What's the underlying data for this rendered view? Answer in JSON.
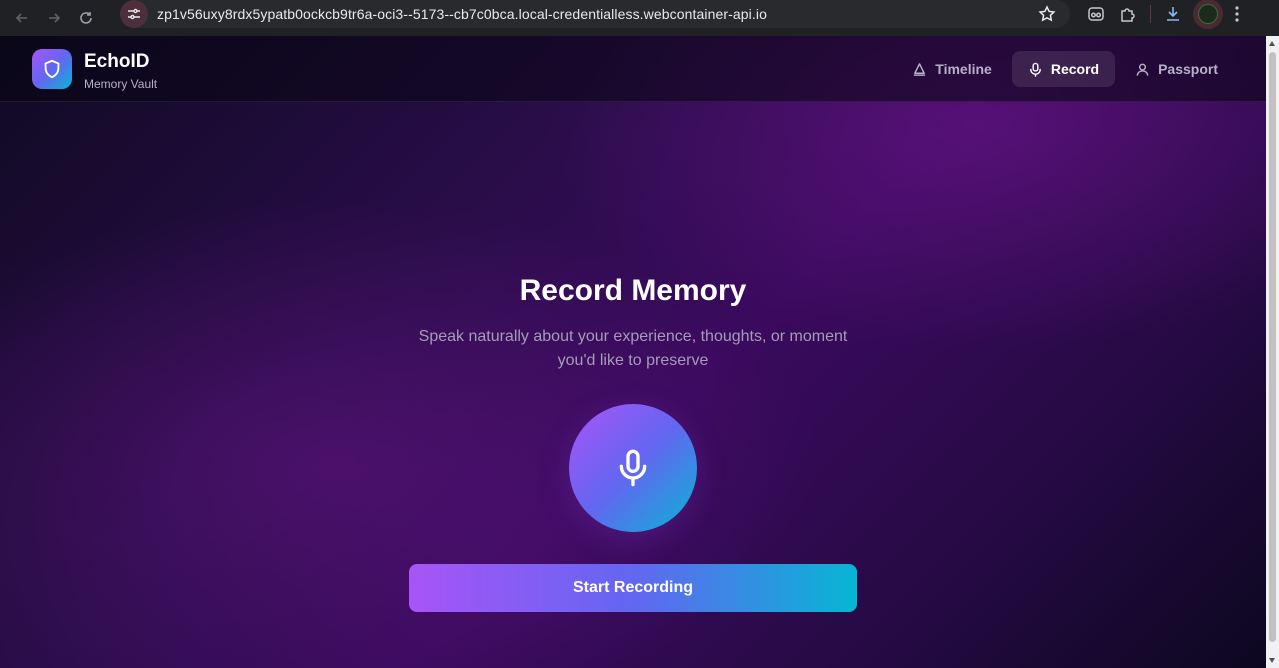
{
  "browser": {
    "url": "zp1v56uxy8rdx5ypatb0ockcb9tr6a-oci3--5173--cb7c0bca.local-credentialless.webcontainer-api.io"
  },
  "app": {
    "name": "EchoID",
    "tagline": "Memory Vault",
    "logo_icon": "shield-icon"
  },
  "nav": {
    "items": [
      {
        "label": "Timeline",
        "icon": "timeline-icon",
        "active": false
      },
      {
        "label": "Record",
        "icon": "mic-icon",
        "active": true
      },
      {
        "label": "Passport",
        "icon": "user-icon",
        "active": false
      }
    ]
  },
  "record": {
    "title": "Record Memory",
    "description": "Speak naturally about your experience, thoughts, or moment you'd like to preserve",
    "mic_icon": "mic-icon",
    "start_label": "Start Recording"
  },
  "colors": {
    "gradient_start": "#a855f7",
    "gradient_mid": "#6366f1",
    "gradient_end": "#06b6d4",
    "background": "#2a0d4a"
  }
}
